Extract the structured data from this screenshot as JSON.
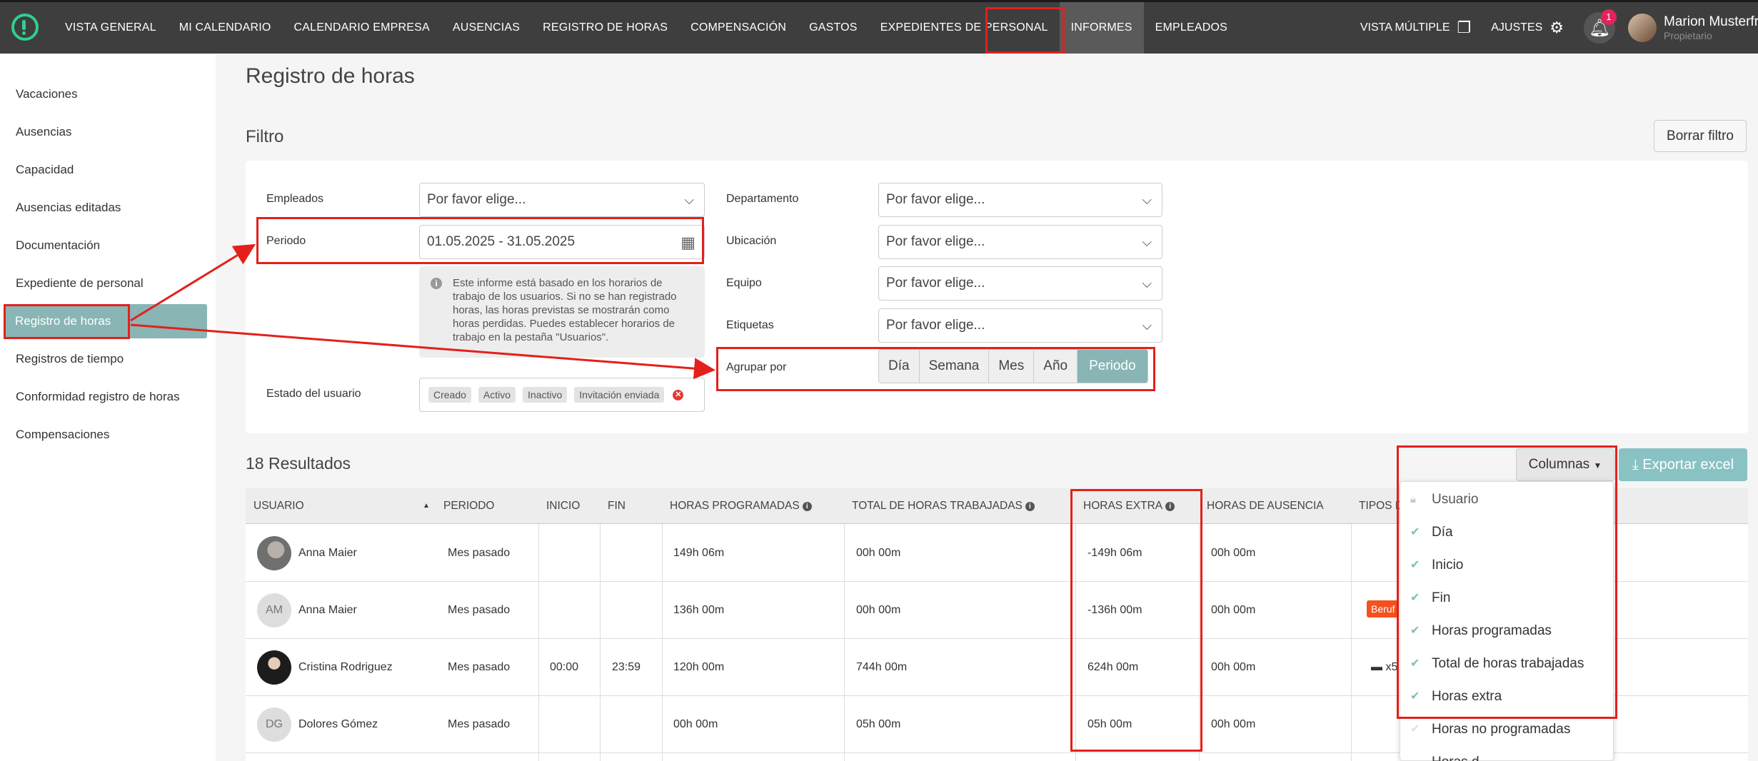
{
  "topnav": {
    "items": [
      "VISTA GENERAL",
      "MI CALENDARIO",
      "CALENDARIO EMPRESA",
      "AUSENCIAS",
      "REGISTRO DE HORAS",
      "COMPENSACIÓN",
      "GASTOS",
      "EXPEDIENTES DE PERSONAL",
      "INFORMES",
      "EMPLEADOS"
    ],
    "active": "INFORMES",
    "multi_view": "VISTA MÚLTIPLE",
    "settings": "AJUSTES",
    "notifications_count": "1",
    "user_name": "Marion Musterfr",
    "user_role": "Propietario"
  },
  "sidebar": {
    "items": [
      "Vacaciones",
      "Ausencias",
      "Capacidad",
      "Ausencias editadas",
      "Documentación",
      "Expediente de personal",
      "Registro de horas",
      "Registros de tiempo",
      "Conformidad registro de horas",
      "Compensaciones"
    ],
    "active": "Registro de horas"
  },
  "page": {
    "title": "Registro de horas",
    "filter_title": "Filtro",
    "clear_filter": "Borrar filtro",
    "results": "18 Resultados",
    "columns_btn": "Columnas",
    "export_btn": "Exportar excel"
  },
  "filter": {
    "empleados_label": "Empleados",
    "empleados_placeholder": "Por favor elige...",
    "periodo_label": "Periodo",
    "periodo_value": "01.05.2025 - 31.05.2025",
    "info_lines": [
      "Este informe está basado en los horarios de",
      "trabajo de los usuarios. Si no se han registrado",
      "horas, las horas previstas se mostrarán como",
      "horas perdidas. Puedes establecer horarios de",
      "trabajo en la pestaña \"Usuarios\"."
    ],
    "estado_label": "Estado del usuario",
    "estado_tags": [
      "Creado",
      "Activo",
      "Inactivo",
      "Invitación enviada"
    ],
    "departamento_label": "Departamento",
    "departamento_placeholder": "Por favor elige...",
    "ubicacion_label": "Ubicación",
    "ubicacion_placeholder": "Por favor elige...",
    "equipo_label": "Equipo",
    "equipo_placeholder": "Por favor elige...",
    "etiquetas_label": "Etiquetas",
    "etiquetas_placeholder": "Por favor elige...",
    "agrupar_label": "Agrupar por",
    "agrupar_options": [
      "Día",
      "Semana",
      "Mes",
      "Año",
      "Periodo"
    ],
    "agrupar_active": "Periodo"
  },
  "table": {
    "headers": {
      "usuario": "USUARIO",
      "periodo": "PERIODO",
      "inicio": "INICIO",
      "fin": "FIN",
      "horas_programadas": "HORAS PROGRAMADAS",
      "total_trabajadas": "TOTAL DE HORAS TRABAJADAS",
      "horas_extra": "HORAS EXTRA",
      "horas_ausencia": "HORAS DE AUSENCIA",
      "tipos": "TIPOS D"
    },
    "rows": [
      {
        "avatar": "",
        "name": "Anna Maier",
        "periodo": "Mes pasado",
        "inicio": "",
        "fin": "",
        "programadas": "149h 06m",
        "trabajadas": "00h 00m",
        "extra": "-149h 06m",
        "ausencia": "00h 00m",
        "tipos": ""
      },
      {
        "avatar": "AM",
        "name": "Anna Maier",
        "periodo": "Mes pasado",
        "inicio": "",
        "fin": "",
        "programadas": "136h 00m",
        "trabajadas": "00h 00m",
        "extra": "-136h 00m",
        "ausencia": "00h 00m",
        "tipos": "Beruf"
      },
      {
        "avatar": "",
        "name": "Cristina Rodriguez",
        "periodo": "Mes pasado",
        "inicio": "00:00",
        "fin": "23:59",
        "programadas": "120h 00m",
        "trabajadas": "744h 00m",
        "extra": "624h 00m",
        "ausencia": "00h 00m",
        "tipos": "x5"
      },
      {
        "avatar": "DG",
        "name": "Dolores Gómez",
        "periodo": "Mes pasado",
        "inicio": "",
        "fin": "",
        "programadas": "00h 00m",
        "trabajadas": "05h 00m",
        "extra": "05h 00m",
        "ausencia": "00h 00m",
        "tipos": ""
      }
    ]
  },
  "columns_menu": {
    "items": [
      "Usuario",
      "Día",
      "Inicio",
      "Fin",
      "Horas programadas",
      "Total de horas trabajadas",
      "Horas extra",
      "Horas no programadas",
      "Horas d"
    ]
  },
  "colors": {
    "topbar": "#3e3e3e",
    "accent_teal": "#89b5b5",
    "highlight_red": "#e3201b",
    "brand_green": "#2fd08e"
  }
}
